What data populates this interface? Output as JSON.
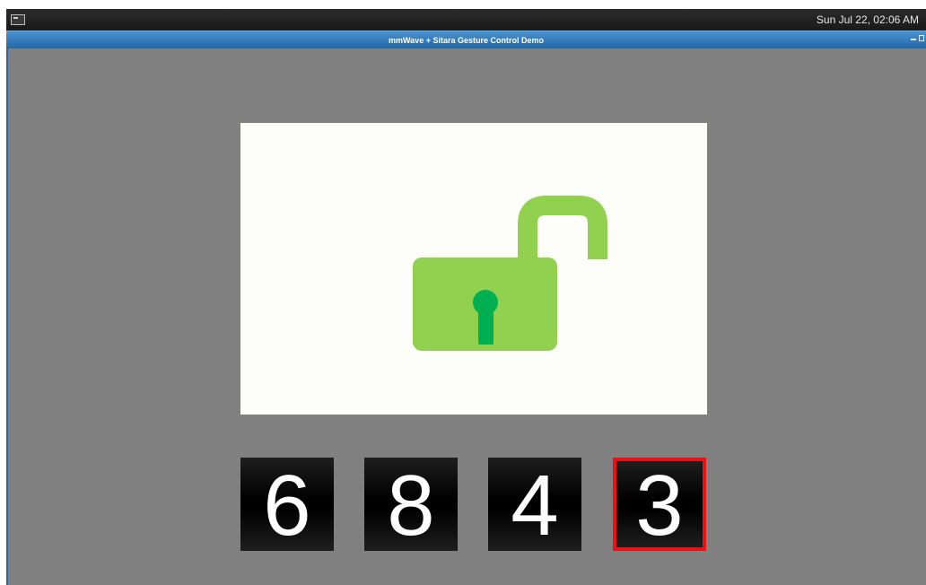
{
  "topbar": {
    "app_icon": "terminal-icon",
    "clock": "Sun Jul 22, 02:06 AM"
  },
  "window": {
    "title": "mmWave + Sitara Gesture Control Demo",
    "controls": [
      "minimize-icon",
      "maximize-icon"
    ]
  },
  "lock": {
    "icon": "unlocked-padlock-icon",
    "state": "unlocked",
    "colors": {
      "body": "#92d050",
      "keyhole": "#00b050",
      "panel": "#fdfdf9"
    }
  },
  "code": {
    "digits": [
      "6",
      "8",
      "4",
      "3"
    ],
    "selected_index": 3,
    "selected_color": "#ee1111"
  }
}
